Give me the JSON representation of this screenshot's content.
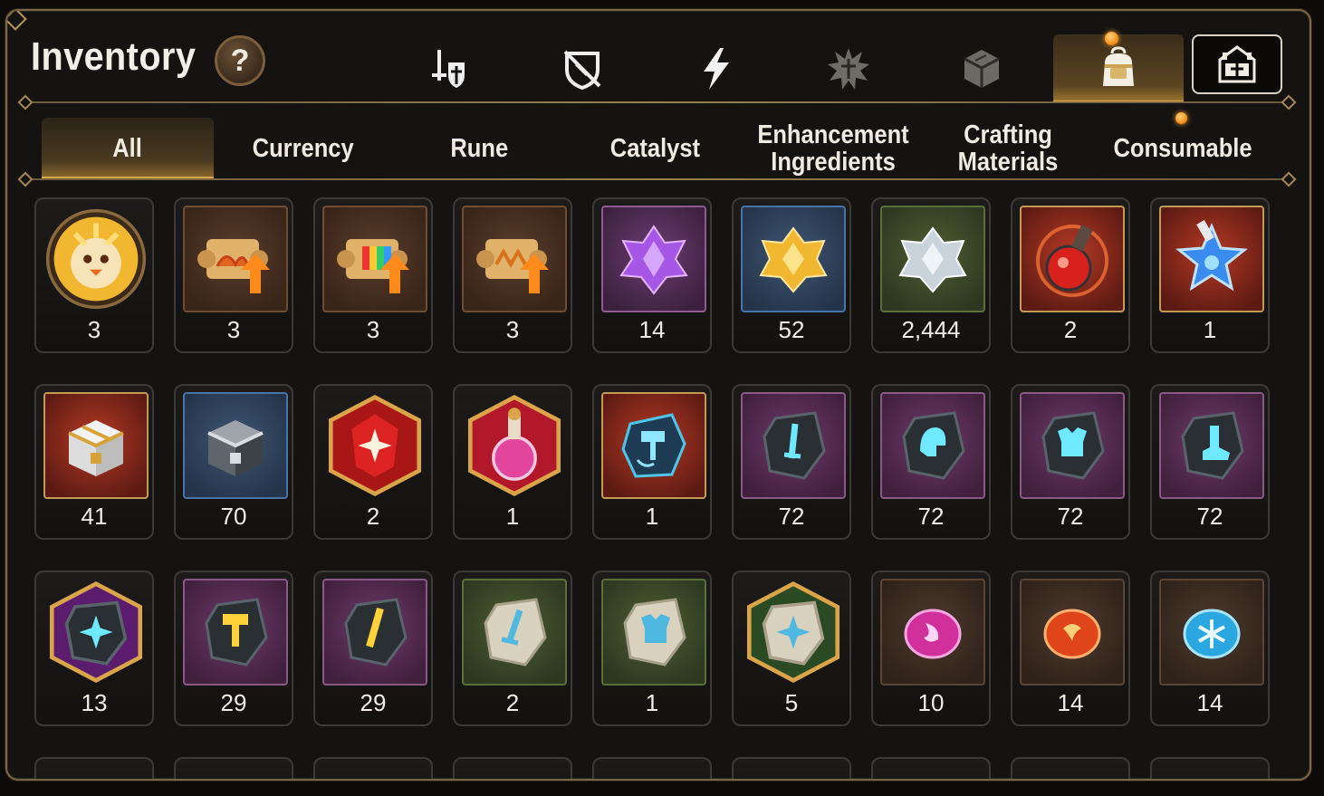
{
  "header": {
    "title": "Inventory",
    "help_label": "?"
  },
  "category_tabs": [
    {
      "icon": "sword-shield-icon",
      "active": false
    },
    {
      "icon": "broken-shield-icon",
      "active": false
    },
    {
      "icon": "lightning-icon",
      "active": false
    },
    {
      "icon": "burst-emblem-icon",
      "active": false
    },
    {
      "icon": "cube-icon",
      "active": false
    },
    {
      "icon": "backpack-icon",
      "active": true,
      "notification": true
    }
  ],
  "guild_button": {
    "icon": "guild-hall-icon"
  },
  "sub_tabs": [
    {
      "label": "All",
      "active": true
    },
    {
      "label": "Currency",
      "active": false
    },
    {
      "label": "Rune",
      "active": false
    },
    {
      "label": "Catalyst",
      "active": false
    },
    {
      "label": "Enhancement Ingredients",
      "active": false
    },
    {
      "label": "Crafting Materials",
      "active": false
    },
    {
      "label": "Consumable",
      "active": false
    }
  ],
  "items": [
    {
      "name": "phoenix-chick-coin",
      "count": "3"
    },
    {
      "name": "fire-scroll-upgrade",
      "count": "3"
    },
    {
      "name": "rainbow-scroll-upgrade",
      "count": "3"
    },
    {
      "name": "gold-scroll-upgrade",
      "count": "3"
    },
    {
      "name": "purple-crystal-cluster",
      "count": "14"
    },
    {
      "name": "gold-crystal-cluster",
      "count": "52"
    },
    {
      "name": "silver-crystal-cluster",
      "count": "2,444"
    },
    {
      "name": "red-potion-flask",
      "count": "2"
    },
    {
      "name": "star-potion",
      "count": "1"
    },
    {
      "name": "gold-treasure-chest",
      "count": "41"
    },
    {
      "name": "silver-treasure-chest",
      "count": "70"
    },
    {
      "name": "red-charm-stone",
      "count": "2"
    },
    {
      "name": "pink-potion-charm",
      "count": "1"
    },
    {
      "name": "hammer-rune-stone",
      "count": "1"
    },
    {
      "name": "sword-rune-stone",
      "count": "72"
    },
    {
      "name": "helmet-rune-stone",
      "count": "72"
    },
    {
      "name": "armor-rune-stone",
      "count": "72"
    },
    {
      "name": "boots-rune-stone",
      "count": "72"
    },
    {
      "name": "star-rune-stone",
      "count": "13"
    },
    {
      "name": "gold-hammer-stone",
      "count": "29"
    },
    {
      "name": "gold-blade-stone",
      "count": "29"
    },
    {
      "name": "pale-sword-stone",
      "count": "2"
    },
    {
      "name": "pale-armor-stone",
      "count": "1"
    },
    {
      "name": "pale-star-stone",
      "count": "5"
    },
    {
      "name": "moon-orb-disc",
      "count": "10"
    },
    {
      "name": "flame-orb-disc",
      "count": "14"
    },
    {
      "name": "frost-orb-disc",
      "count": "14"
    }
  ],
  "colors": {
    "accent": "#e5b44e",
    "frame": "#7a6644",
    "background": "#141311"
  }
}
